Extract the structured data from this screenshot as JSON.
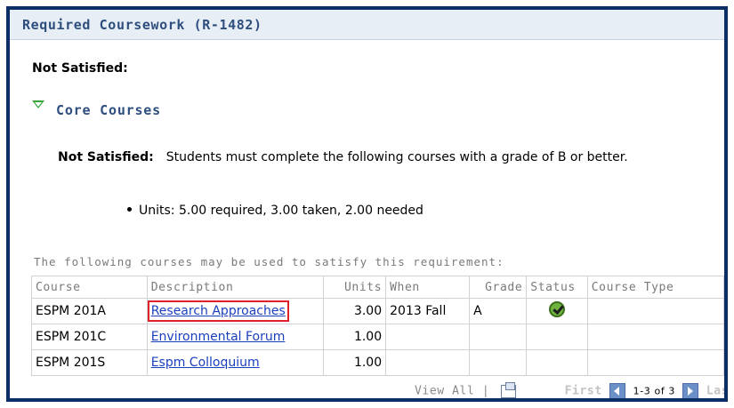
{
  "header": {
    "title": "Required Coursework (R-1482)"
  },
  "top_status": "Not Satisfied:",
  "section": {
    "title": "Core Courses"
  },
  "requirement": {
    "status_label": "Not Satisfied:",
    "text": "Students must complete the following courses with a grade of B or better."
  },
  "units_bullet": "Units: 5.00 required, 3.00 taken, 2.00 needed",
  "courses_intro": "The following courses may be used to satisfy this requirement:",
  "table": {
    "headers": {
      "course": "Course",
      "description": "Description",
      "units": "Units",
      "when": "When",
      "grade": "Grade",
      "status": "Status",
      "course_type": "Course Type"
    },
    "rows": [
      {
        "course": "ESPM 201A",
        "description": "Research Approaches",
        "units": "3.00",
        "when": "2013 Fall",
        "grade": "A",
        "status_icon": "check-icon"
      },
      {
        "course": "ESPM 201C",
        "description": "Environmental Forum",
        "units": "1.00",
        "when": "",
        "grade": "",
        "status_icon": ""
      },
      {
        "course": "ESPM 201S",
        "description": "Espm Colloquium",
        "units": "1.00",
        "when": "",
        "grade": "",
        "status_icon": ""
      }
    ]
  },
  "footer": {
    "view_all": "View All",
    "separator": "|",
    "first": "First",
    "range": "1-3 of 3",
    "last": "Last"
  }
}
